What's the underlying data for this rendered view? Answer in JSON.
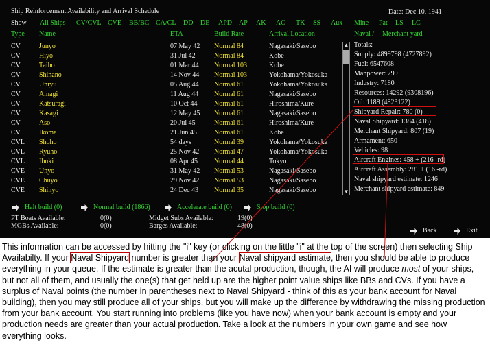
{
  "game": {
    "title": "Ship Reinforcement Availability and Arrival Schedule",
    "date": "Date: Dec 10, 1941",
    "filter_label": "Show",
    "filters": [
      "All Ships",
      "CV/CVL",
      "CVE",
      "BB/BC",
      "CA/CL",
      "DD",
      "DE",
      "APD",
      "AP",
      "AK",
      "AO",
      "TK",
      "SS",
      "Aux",
      "Mine",
      "Pat",
      "LS",
      "LC"
    ],
    "headers": {
      "type": "Type",
      "name": "Name",
      "eta": "ETA",
      "build_rate": "Build Rate",
      "arrival": "Arrival Location",
      "naval": "Naval /",
      "merchant": "Merchant yard"
    },
    "ships": [
      {
        "type": "CV",
        "name": "Junyo",
        "eta": "07 May 42",
        "rate": "Normal 84",
        "loc": "Nagasaki/Sasebo"
      },
      {
        "type": "CV",
        "name": "Hiyo",
        "eta": "31 Jul 42",
        "rate": "Normal 84",
        "loc": "Kobe"
      },
      {
        "type": "CV",
        "name": "Taiho",
        "eta": "01 Mar 44",
        "rate": "Normal 103",
        "loc": "Kobe"
      },
      {
        "type": "CV",
        "name": "Shinano",
        "eta": "14 Nov 44",
        "rate": "Normal 103",
        "loc": "Yokohama/Yokosuka"
      },
      {
        "type": "CV",
        "name": "Unryu",
        "eta": "05 Aug 44",
        "rate": "Normal 61",
        "loc": "Yokohama/Yokosuka"
      },
      {
        "type": "CV",
        "name": "Amagi",
        "eta": "11 Aug 44",
        "rate": "Normal 61",
        "loc": "Nagasaki/Sasebo"
      },
      {
        "type": "CV",
        "name": "Katsuragi",
        "eta": "10 Oct 44",
        "rate": "Normal 61",
        "loc": "Hiroshima/Kure"
      },
      {
        "type": "CV",
        "name": "Kasagi",
        "eta": "12 May 45",
        "rate": "Normal 61",
        "loc": "Nagasaki/Sasebo"
      },
      {
        "type": "CV",
        "name": "Aso",
        "eta": "20 Jul 45",
        "rate": "Normal 61",
        "loc": "Hiroshima/Kure"
      },
      {
        "type": "CV",
        "name": "Ikoma",
        "eta": "21 Jun 45",
        "rate": "Normal 61",
        "loc": "Kobe"
      },
      {
        "type": "CVL",
        "name": "Shoho",
        "eta": "54 days",
        "rate": "Normal 39",
        "loc": "Yokohama/Yokosuka"
      },
      {
        "type": "CVL",
        "name": "Ryuho",
        "eta": "25 Nov 42",
        "rate": "Normal 47",
        "loc": "Yokohama/Yokosuka"
      },
      {
        "type": "CVL",
        "name": "Ibuki",
        "eta": "08 Apr 45",
        "rate": "Normal 44",
        "loc": "Tokyo"
      },
      {
        "type": "CVE",
        "name": "Unyo",
        "eta": "31 May 42",
        "rate": "Normal 53",
        "loc": "Nagasaki/Sasebo"
      },
      {
        "type": "CVE",
        "name": "Chuyo",
        "eta": "29 Nov 42",
        "rate": "Normal 53",
        "loc": "Nagasaki/Sasebo"
      },
      {
        "type": "CVE",
        "name": "Shinyo",
        "eta": "24 Dec 43",
        "rate": "Normal 35",
        "loc": "Nagasaki/Sasebo"
      }
    ],
    "totals": [
      "Totals:",
      "Supply: 4899798 (4727892)",
      "Fuel: 6547608",
      "Manpower: 799",
      "Industry: 7180",
      "Resources: 14292 (9308196)",
      "Oil: 1188 (4823122)",
      "Shipyard Repair: 780 (0)",
      "Naval Shipyard: 1384 (418)",
      "Merchant Shipyard: 807 (19)",
      "Armament: 650",
      "Vehicles: 98",
      "Aircraft Engines: 458 + (216 -rd)",
      "Aircraft Assembly: 281 + (16 -rd)",
      "Naval shipyard estimate: 1246",
      "Merchant shipyard estimate: 849"
    ],
    "commands": {
      "halt": "Halt build (0)",
      "normal": "Normal build (1866)",
      "accelerate": "Accelerate build (0)",
      "stop": "Stop build (0)"
    },
    "bottom": {
      "pt_label": "PT Boats Available:",
      "pt_value": "0(0)",
      "mgb_label": "MGBs Available:",
      "mgb_value": "0(0)",
      "midget_label": "Midget Subs Available:",
      "midget_value": "19(0)",
      "barges_label": "Barges Available:",
      "barges_value": "48(0)"
    },
    "nav": {
      "back": "Back",
      "exit": "Exit"
    },
    "colors": {
      "background": "#070707",
      "text": "#e8e8e8",
      "ship_text": "#f0e234",
      "command_text": "#33d633",
      "highlight": "#d01010"
    }
  },
  "caption": {
    "p1": "This information can be accessed by hitting the \"i\" key (or clicking on the little \"i\" at the top of the screen) then selecting Ship Availabilty.  If your ",
    "naval_shipyard": "Naval Shipyard",
    "p2": " number is greater than your ",
    "naval_estimate": "Naval shipyard estimate",
    "p3": ", then you should be able to produce everything in your queue.  If the estimate is greater than the acutal production, though, the AI will produce ",
    "most": "most",
    "p4": " of your ships, but not all of them, and usually the one(s) that get held up are the higher point value ships like BBs and CVs.  If you have a surplus of Naval points (the number in parentheses next to Naval Shipyard - think of this as your bank account for Naval building), then you may still produce all of your ships, but you will make up the difference by withdrawing the missing production from your bank account.  You start running into problems (like you have now) when your bank account is empty and your production needs are greater than your actual production.  Take a look at the numbers in your own game and see how everything looks."
  }
}
